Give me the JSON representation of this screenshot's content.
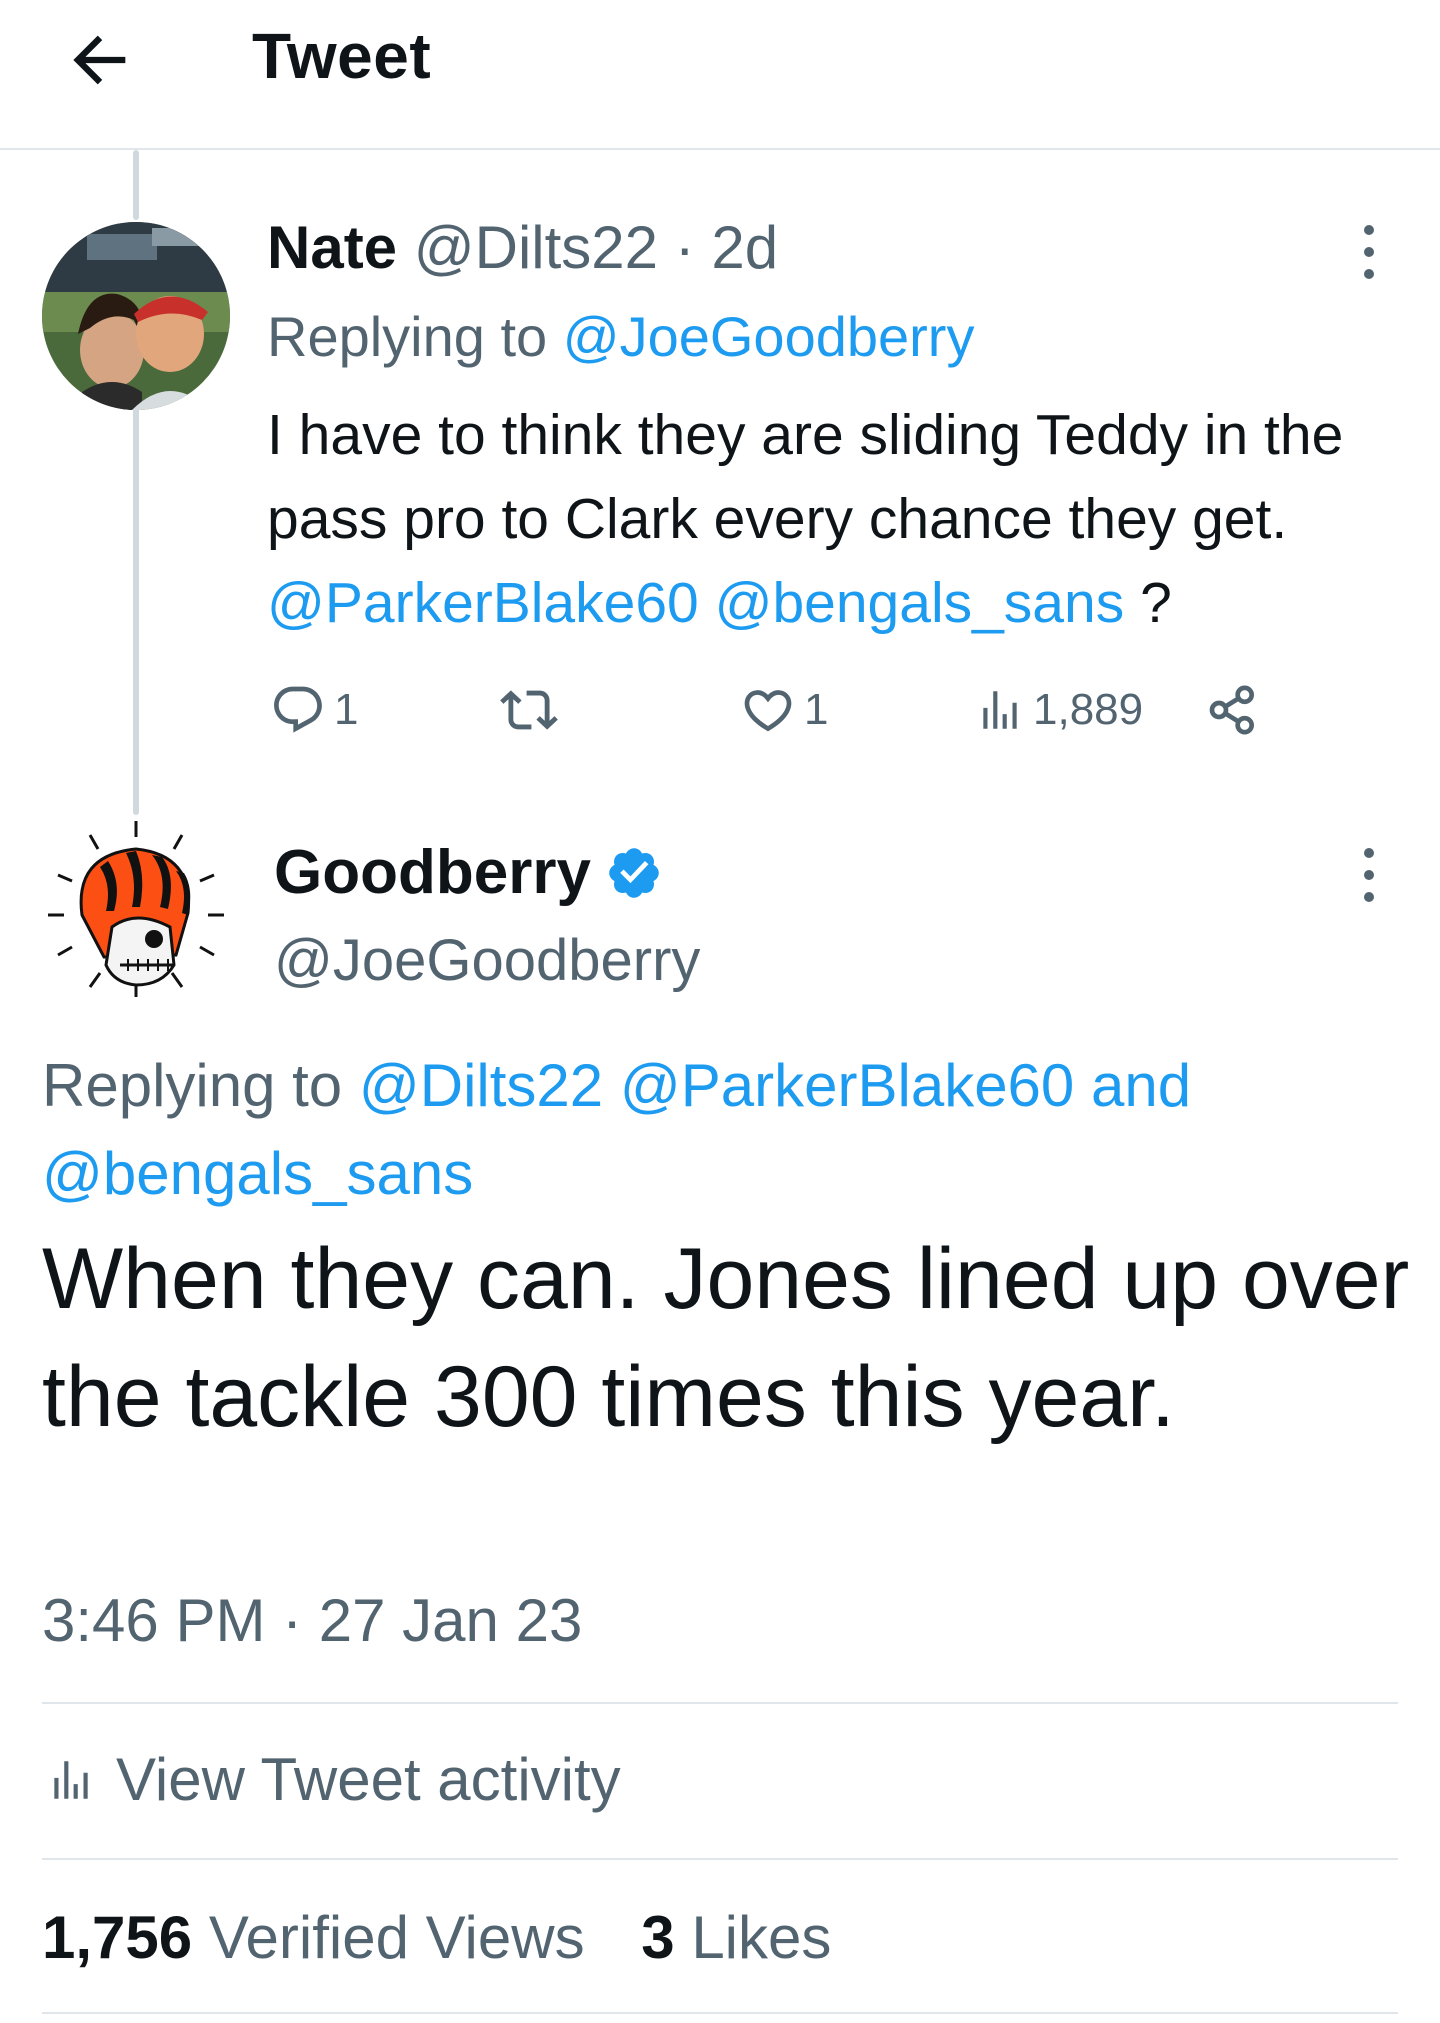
{
  "header": {
    "title": "Tweet",
    "back_icon": "arrow-left-icon"
  },
  "reply_tweet": {
    "name": "Nate",
    "handle": "@Dilts22",
    "separator": "·",
    "time": "2d",
    "replying_prefix": "Replying to",
    "replying_to": "@JoeGoodberry",
    "body_text": "I have to think they are sliding Teddy in the pass pro to Clark every chance they get.",
    "mention_1": "@ParkerBlake60",
    "mention_2": "@bengals_sans",
    "body_end": "?",
    "actions": {
      "reply_count": "1",
      "retweet_count": "",
      "like_count": "1",
      "views_count": "1,889"
    },
    "icons": [
      "comment-icon",
      "retweet-icon",
      "heart-icon",
      "views-icon",
      "share-icon",
      "more-icon"
    ]
  },
  "main_tweet": {
    "name": "Goodberry",
    "handle": "@JoeGoodberry",
    "verified": true,
    "replying_prefix": "Replying to",
    "replying_to_1": "@Dilts22",
    "replying_to_2": "@ParkerBlake60",
    "replying_and": "and",
    "replying_to_3": "@bengals_sans",
    "body": "When they can. Jones lined up over the tackle 300 times this year.",
    "timestamp": "3:46 PM · 27 Jan 23",
    "activity_label": "View Tweet activity",
    "views_count": "1,756",
    "views_label": "Verified Views",
    "likes_count": "3",
    "likes_label": "Likes"
  },
  "colors": {
    "link": "#1d9bf0",
    "muted": "#536471",
    "text": "#0f1419",
    "divider": "#e1e6ea",
    "verified": "#1d9bf0",
    "bengals_orange": "#fb4f14"
  }
}
